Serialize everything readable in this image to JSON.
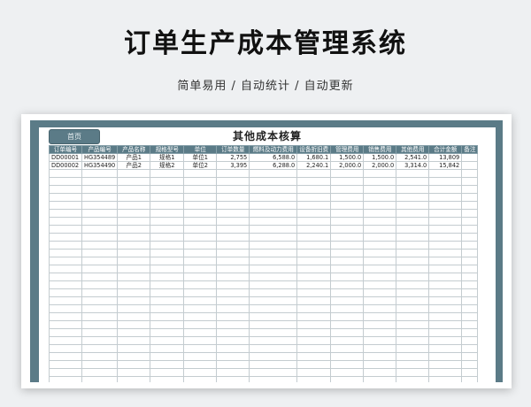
{
  "page": {
    "title": "订单生产成本管理系统",
    "subtitle": "简单易用 / 自动统计 / 自动更新"
  },
  "sheet": {
    "home_button": "首页",
    "title": "其他成本核算",
    "headers": [
      "订单编号",
      "产品编号",
      "产品名称",
      "规格型号",
      "单位",
      "订单数量",
      "燃料及动力费用",
      "设备折旧费",
      "管理费用",
      "销售费用",
      "其他费用",
      "合计金额",
      "备注"
    ],
    "rows": [
      [
        "DD00001",
        "HG354489",
        "产品1",
        "规格1",
        "单位1",
        "2,755",
        "6,588.0",
        "1,680.1",
        "1,500.0",
        "1,500.0",
        "2,541.0",
        "13,809",
        ""
      ],
      [
        "DD00002",
        "HG354490",
        "产品2",
        "规格2",
        "单位2",
        "3,395",
        "6,288.0",
        "2,240.1",
        "2,000.0",
        "2,000.0",
        "3,314.0",
        "15,842",
        ""
      ]
    ],
    "empty_rows": 29
  }
}
